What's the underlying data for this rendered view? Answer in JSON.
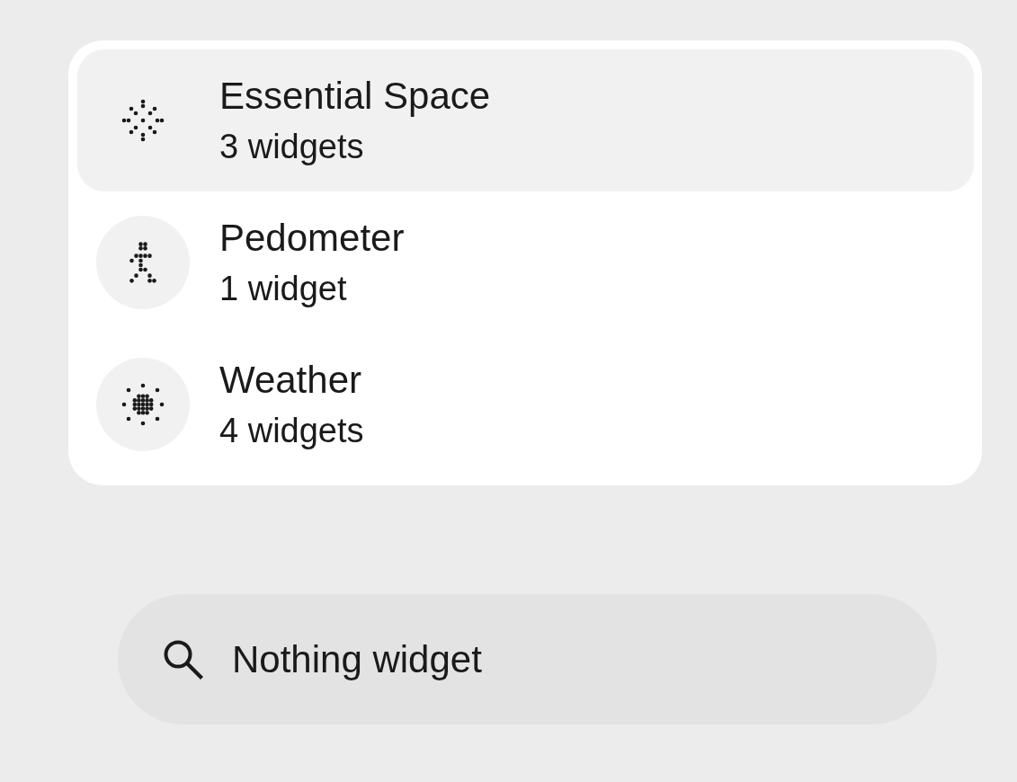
{
  "widget_groups": [
    {
      "name": "Essential Space",
      "count": "3 widgets",
      "selected": true
    },
    {
      "name": "Pedometer",
      "count": "1 widget",
      "selected": false
    },
    {
      "name": "Weather",
      "count": "4 widgets",
      "selected": false
    }
  ],
  "search": {
    "value": "Nothing widget"
  }
}
